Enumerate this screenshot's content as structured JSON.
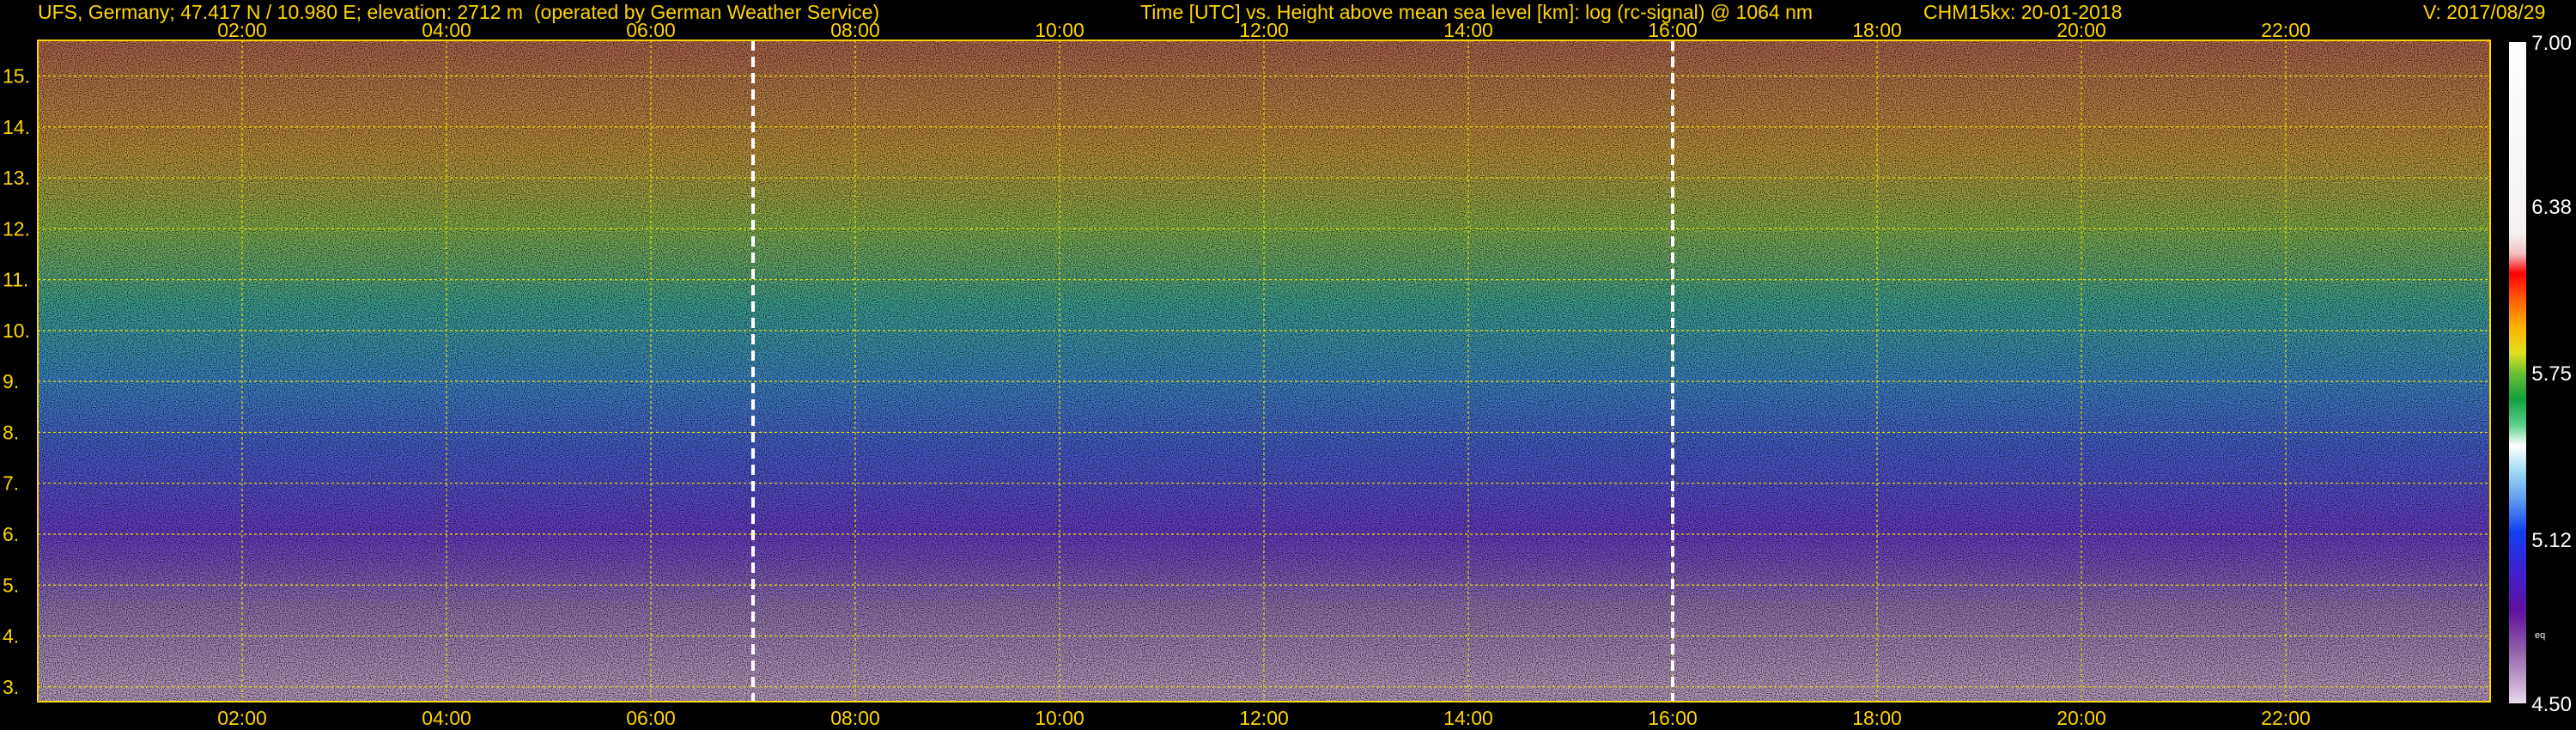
{
  "header": {
    "station": "UFS, Germany; 47.417 N / 10.980 E; elevation: 2712 m  (operated by German Weather Service)",
    "plot_title": "Time [UTC] vs. Height above mean sea level [km]: log (rc-signal) @ 1064 nm",
    "instrument_date": "CHM15kx: 20-01-2018",
    "version": "V: 2017/08/29"
  },
  "colors": {
    "background": "#000000",
    "text": "#ffd400",
    "grid": "#e8e000",
    "marker_line": "#ffffff",
    "colorbar_label": "#ffffff"
  },
  "chart_data": {
    "type": "heatmap",
    "title": "Time [UTC] vs. Height above mean sea level [km]: log (rc-signal) @ 1064 nm",
    "x_ticks": [
      "02:00",
      "04:00",
      "06:00",
      "08:00",
      "10:00",
      "12:00",
      "14:00",
      "16:00",
      "18:00",
      "20:00",
      "22:00"
    ],
    "x_tick_hours": [
      2,
      4,
      6,
      8,
      10,
      12,
      14,
      16,
      18,
      20,
      22
    ],
    "xlim_hours": [
      0,
      24
    ],
    "y_ticks": [
      "3.",
      "4.",
      "5.",
      "6.",
      "7.",
      "8.",
      "9.",
      "10.",
      "11.",
      "12.",
      "13.",
      "14.",
      "15."
    ],
    "y_tick_values": [
      3,
      4,
      5,
      6,
      7,
      8,
      9,
      10,
      11,
      12,
      13,
      14,
      15
    ],
    "ylim_km": [
      2.71,
      15.7
    ],
    "grid": true,
    "marker_lines_hours": [
      7.0,
      16.0
    ],
    "colorbar": {
      "range": [
        4.5,
        7.0
      ],
      "tick_labels": [
        "7.00",
        "6.38",
        "5.75",
        "5.12",
        "4.50"
      ],
      "tick_values": [
        7.0,
        6.38,
        5.75,
        5.12,
        4.5
      ],
      "small_label": "eq"
    },
    "signal_profile": [
      {
        "height_km": 3.0,
        "color": "#c8a8d0"
      },
      {
        "height_km": 4.5,
        "color": "#a080c0"
      },
      {
        "height_km": 6.0,
        "color": "#7040d8"
      },
      {
        "height_km": 7.5,
        "color": "#5060e0"
      },
      {
        "height_km": 9.0,
        "color": "#4090d8"
      },
      {
        "height_km": 10.5,
        "color": "#40b0a0"
      },
      {
        "height_km": 12.0,
        "color": "#90c050"
      },
      {
        "height_km": 13.5,
        "color": "#d0a040"
      },
      {
        "height_km": 15.5,
        "color": "#c07050"
      }
    ]
  }
}
